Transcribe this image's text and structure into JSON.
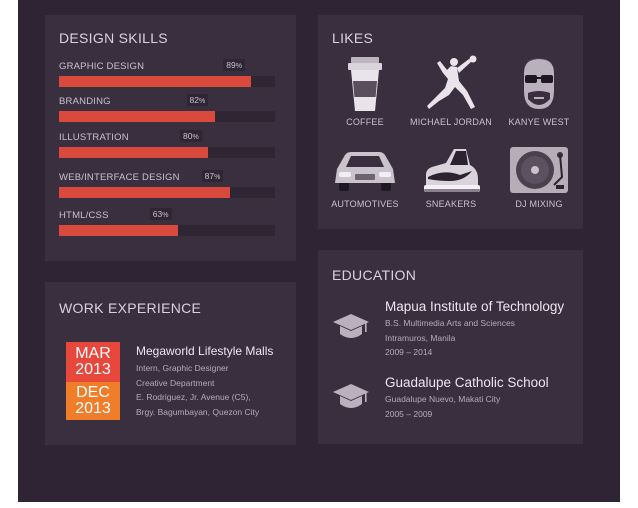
{
  "skills": {
    "title": "DESIGN SKILLS",
    "items": [
      {
        "label": "GRAPHIC DESIGN",
        "pct": 89,
        "pct_text": "89"
      },
      {
        "label": "BRANDING",
        "pct": 72,
        "pct_text": "82"
      },
      {
        "label": "ILLUSTRATION",
        "pct": 69,
        "pct_text": "80"
      },
      {
        "label": "WEB/INTERFACE DESIGN",
        "pct": 79,
        "pct_text": "87"
      },
      {
        "label": "HTML/CSS",
        "pct": 55,
        "pct_text": "63"
      }
    ],
    "pct_symbol": "%"
  },
  "likes": {
    "title": "LIKES",
    "items": [
      {
        "label": "COFFEE",
        "icon": "coffee-cup-icon"
      },
      {
        "label": "MICHAEL JORDAN",
        "icon": "jumpman-icon"
      },
      {
        "label": "KANYE WEST",
        "icon": "kanye-face-icon"
      },
      {
        "label": "AUTOMOTIVES",
        "icon": "car-icon"
      },
      {
        "label": "SNEAKERS",
        "icon": "sneaker-icon"
      },
      {
        "label": "DJ MIXING",
        "icon": "turntable-icon"
      }
    ]
  },
  "work": {
    "title": "WORK EXPERIENCE",
    "start": {
      "month": "MAR",
      "year": "2013"
    },
    "end": {
      "month": "DEC",
      "year": "2013"
    },
    "company": "Megaworld Lifestyle Malls",
    "lines": [
      "Intern, Graphic Designer",
      "Creative Department",
      "E. Rodriguez, Jr. Avenue (C5),",
      "Brgy. Bagumbayan, Quezon City"
    ]
  },
  "education": {
    "title": "EDUCATION",
    "items": [
      {
        "school": "Mapua Institute of Technology",
        "lines": [
          "B.S. Multimedia Arts and Sciences",
          "Intramuros, Manila",
          "2009 – 2014"
        ]
      },
      {
        "school": "Guadalupe Catholic School",
        "lines": [
          "Guadalupe Nuevo, Makati City",
          "2005 – 2009"
        ]
      }
    ]
  },
  "colors": {
    "background": "#2e2433",
    "card": "#3a2f3f",
    "bar": "#d94a3c",
    "date_start": "#e8473c",
    "date_end": "#f07d2a"
  }
}
